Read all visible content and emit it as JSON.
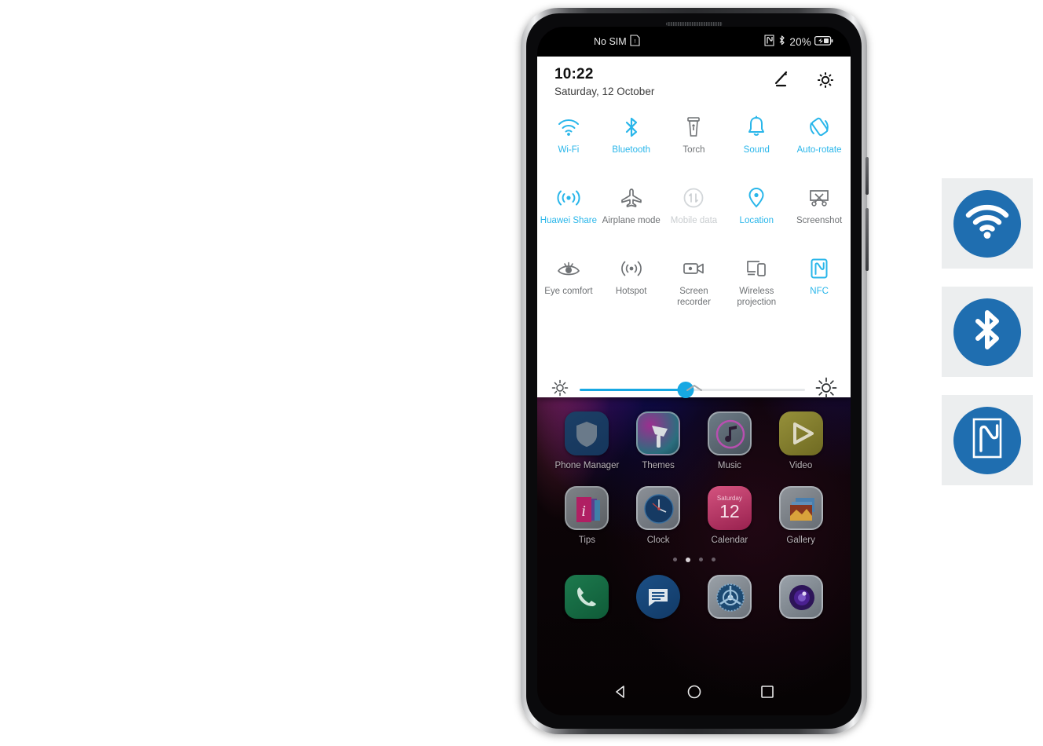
{
  "colors": {
    "accent_cyan": "#29b6ea",
    "slider_blue": "#17a8e3",
    "callout_blue": "#1f6eb0",
    "callout_bg": "#eceeef",
    "tile_off": "#6f7275",
    "tile_disabled": "#c9cdd0"
  },
  "statusbar": {
    "sim_text": "No SIM",
    "sim_icon": "sim-card-icon",
    "nfc_icon": "nfc-icon",
    "bluetooth_icon": "bluetooth-icon",
    "battery_percent": "20%",
    "battery_icon": "battery-charging-icon"
  },
  "quick_settings": {
    "time": "10:22",
    "date": "Saturday, 12 October",
    "edit_icon": "pencil-edit-icon",
    "settings_icon": "gear-icon",
    "collapse_icon": "chevron-up-icon",
    "tiles": [
      {
        "label": "Wi-Fi",
        "icon": "wifi-icon",
        "state": "on"
      },
      {
        "label": "Bluetooth",
        "icon": "bluetooth-icon",
        "state": "on"
      },
      {
        "label": "Torch",
        "icon": "torch-icon",
        "state": "off"
      },
      {
        "label": "Sound",
        "icon": "bell-icon",
        "state": "on"
      },
      {
        "label": "Auto-rotate",
        "icon": "auto-rotate-icon",
        "state": "on"
      },
      {
        "label": "Huawei Share",
        "icon": "huawei-share-icon",
        "state": "on"
      },
      {
        "label": "Airplane mode",
        "icon": "airplane-icon",
        "state": "off"
      },
      {
        "label": "Mobile data",
        "icon": "mobile-data-icon",
        "state": "dis"
      },
      {
        "label": "Location",
        "icon": "location-pin-icon",
        "state": "on"
      },
      {
        "label": "Screenshot",
        "icon": "screenshot-icon",
        "state": "off"
      },
      {
        "label": "Eye comfort",
        "icon": "eye-comfort-icon",
        "state": "off"
      },
      {
        "label": "Hotspot",
        "icon": "hotspot-icon",
        "state": "off"
      },
      {
        "label": "Screen\nrecorder",
        "icon": "screen-recorder-icon",
        "state": "off"
      },
      {
        "label": "Wireless\nprojection",
        "icon": "wireless-projection-icon",
        "state": "off"
      },
      {
        "label": "NFC",
        "icon": "nfc-icon",
        "state": "on"
      }
    ],
    "brightness": {
      "low_icon": "brightness-low-icon",
      "high_icon": "brightness-high-icon",
      "value_percent": 47
    }
  },
  "home_screen": {
    "rows": [
      [
        {
          "label": "Phone Manager",
          "icon": "phone-manager-icon"
        },
        {
          "label": "Themes",
          "icon": "themes-icon"
        },
        {
          "label": "Music",
          "icon": "music-icon"
        },
        {
          "label": "Video",
          "icon": "video-icon"
        }
      ],
      [
        {
          "label": "Tips",
          "icon": "tips-icon"
        },
        {
          "label": "Clock",
          "icon": "clock-icon"
        },
        {
          "label": "Calendar",
          "icon": "calendar-icon",
          "day_name": "Saturday",
          "day_number": "12"
        },
        {
          "label": "Gallery",
          "icon": "gallery-icon"
        }
      ]
    ],
    "page_dots": {
      "count": 4,
      "active_index": 1
    },
    "dock": [
      {
        "label": "Phone",
        "icon": "phone-dialer-icon"
      },
      {
        "label": "Messages",
        "icon": "messages-icon"
      },
      {
        "label": "Settings",
        "icon": "settings-gear-icon"
      },
      {
        "label": "Camera",
        "icon": "camera-icon"
      }
    ],
    "navbar": [
      {
        "label": "Back",
        "icon": "back-triangle-icon"
      },
      {
        "label": "Home",
        "icon": "home-circle-icon"
      },
      {
        "label": "Recents",
        "icon": "recents-square-icon"
      }
    ]
  },
  "callouts": [
    {
      "label": "Wi-Fi",
      "icon": "wifi-icon"
    },
    {
      "label": "Bluetooth",
      "icon": "bluetooth-icon"
    },
    {
      "label": "NFC",
      "icon": "nfc-icon"
    }
  ]
}
